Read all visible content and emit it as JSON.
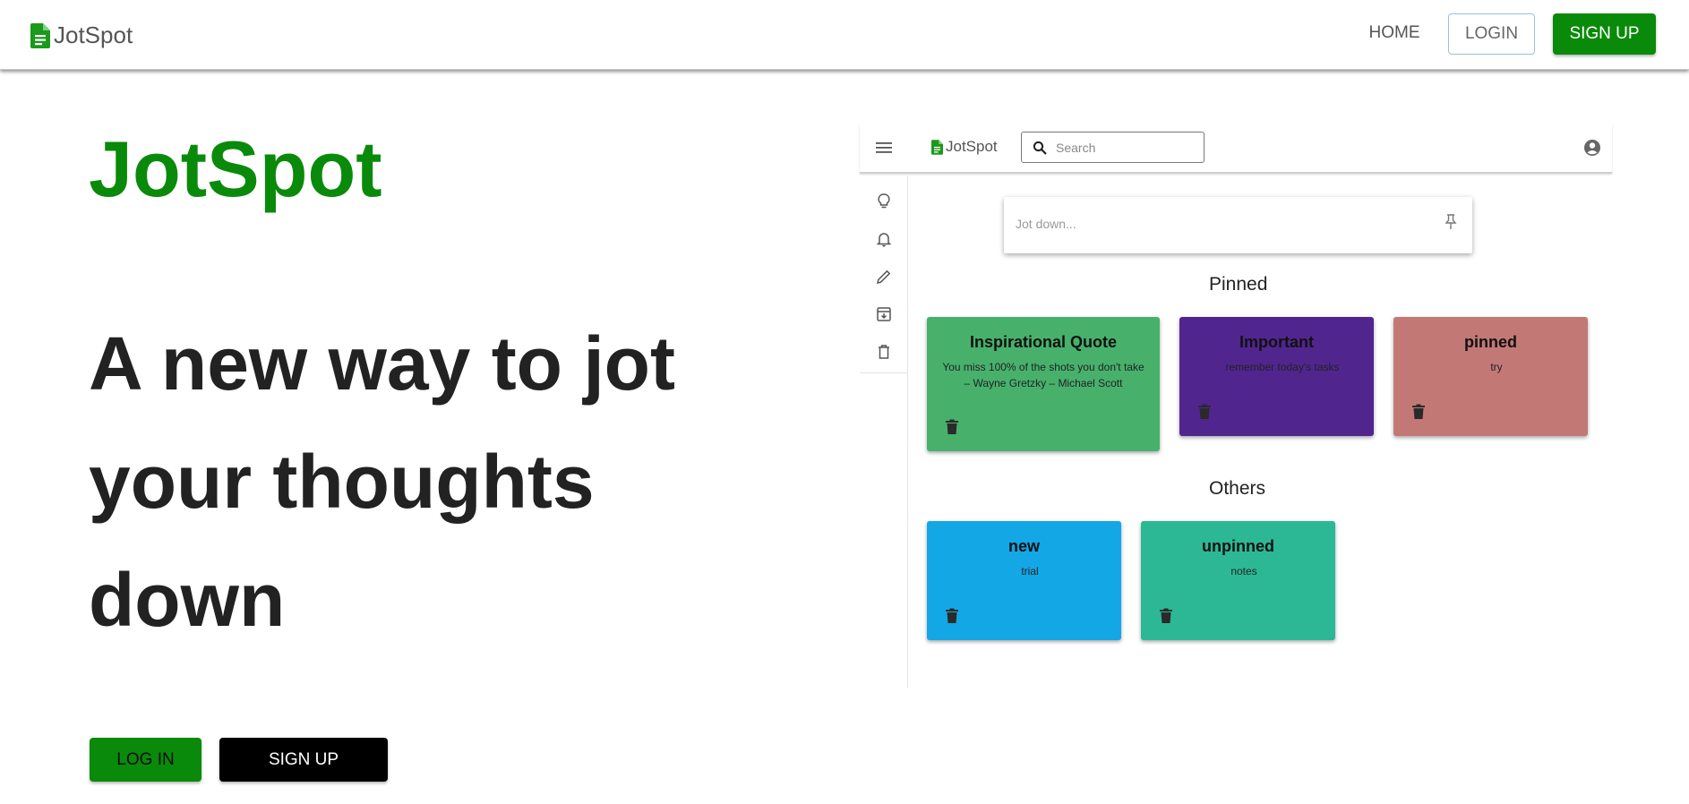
{
  "navbar": {
    "brand": "JotSpot",
    "home_label": "HOME",
    "login_label": "LOGIN",
    "signup_label": "SIGN UP"
  },
  "hero": {
    "title": "JotSpot",
    "tagline": "A new way to jot your thoughts down",
    "login_button": "LOG IN",
    "signup_button": "SIGN UP"
  },
  "preview": {
    "brand": "JotSpot",
    "search_placeholder": "Search",
    "jot_placeholder": "Jot down...",
    "sidebar_icons": [
      "lightbulb-icon",
      "bell-icon",
      "pencil-icon",
      "archive-icon",
      "trash-icon"
    ],
    "pinned_label": "Pinned",
    "others_label": "Others",
    "pinned_notes": [
      {
        "title": "Inspirational Quote",
        "body": "You miss 100% of the shots you don't take – Wayne Gretzky – Michael Scott",
        "color": "#47b16c"
      },
      {
        "title": "Important",
        "body": "remember today's tasks",
        "color": "#51258e"
      },
      {
        "title": "pinned",
        "body": "try",
        "color": "#c27976"
      }
    ],
    "other_notes": [
      {
        "title": "new",
        "body": "trial",
        "color": "#14a7e6"
      },
      {
        "title": "unpinned",
        "body": "notes",
        "color": "#2cb895"
      }
    ]
  },
  "colors": {
    "brand_green": "#0a8a0a",
    "text_dark": "#222222"
  }
}
